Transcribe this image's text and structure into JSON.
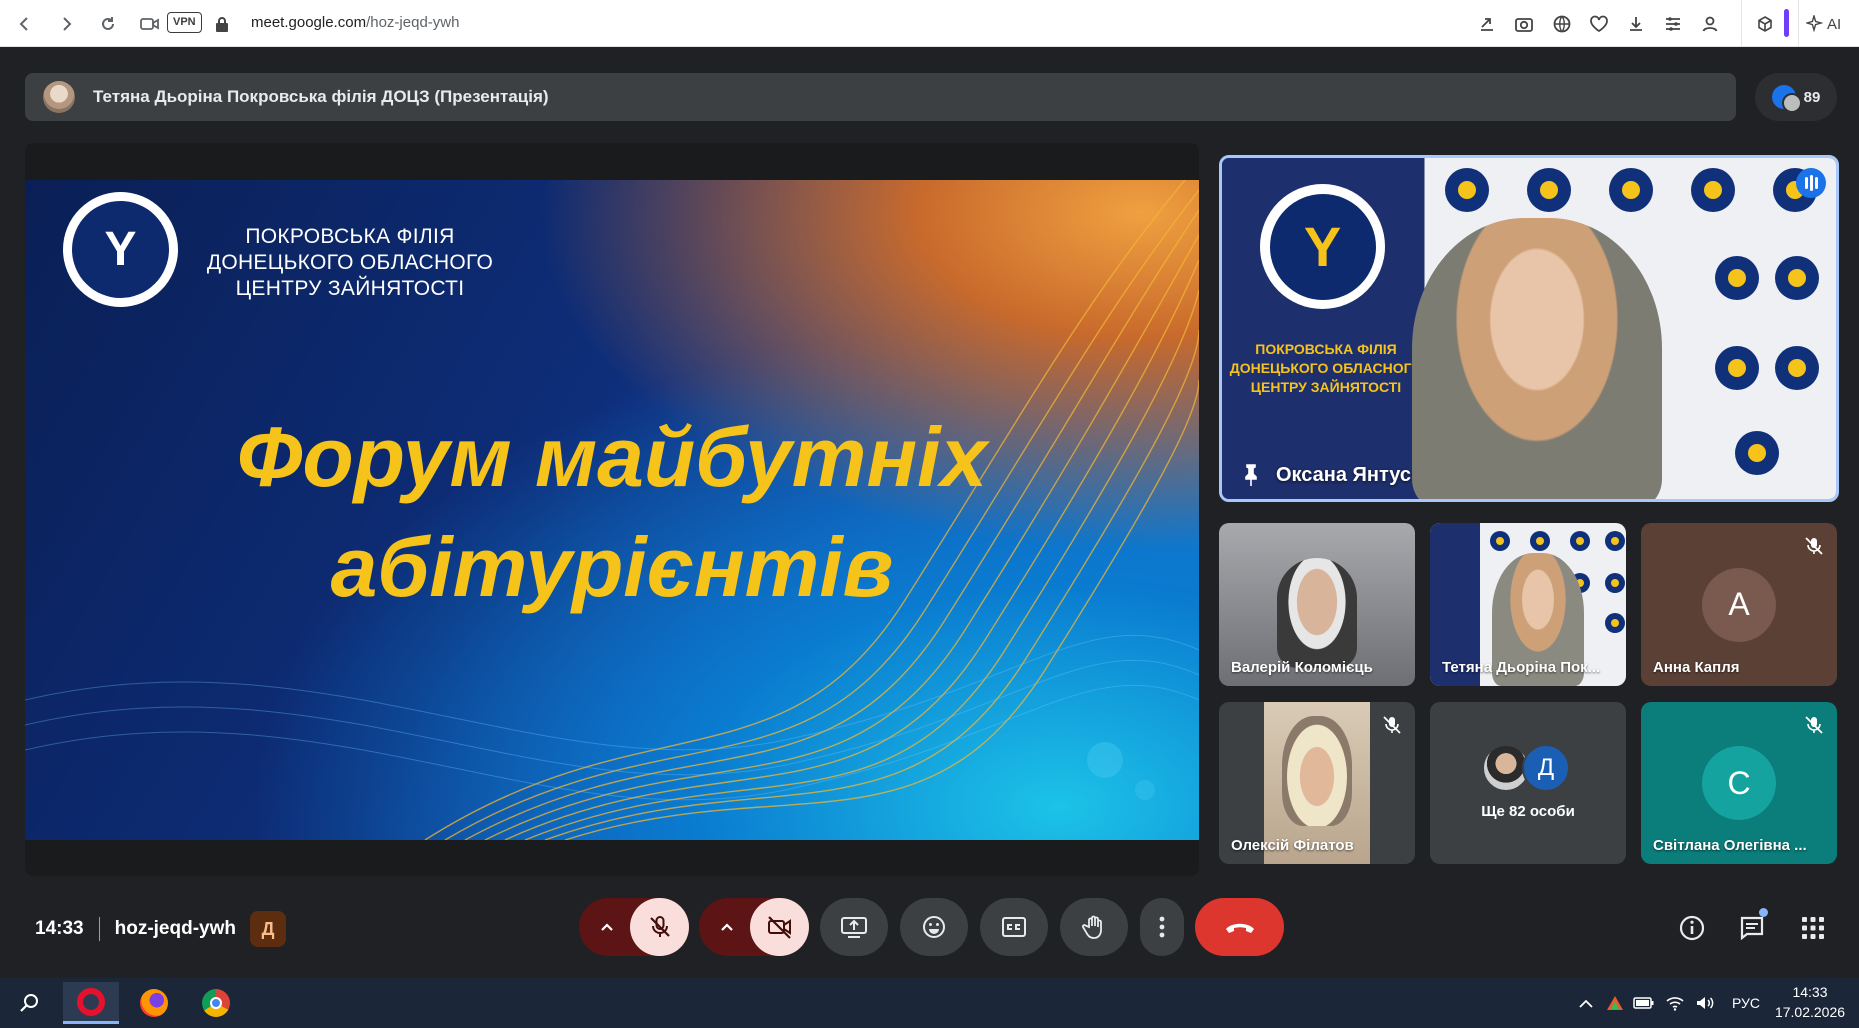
{
  "browser": {
    "vpn_label": "VPN",
    "url_domain": "meet.google.com",
    "url_path": "/hoz-jeqd-ywh",
    "ai_label": "AI"
  },
  "meeting": {
    "presentation_title": "Тетяна Дьоріна Покровська філія ДОЦЗ (Презентація)",
    "participant_count": "89",
    "time": "14:33",
    "code": "hoz-jeqd-ywh",
    "host_badge": "Д"
  },
  "slide": {
    "org_line1": "ПОКРОВСЬКА ФІЛІЯ",
    "org_line2": "ДОНЕЦЬКОГО ОБЛАСНОГО",
    "org_line3": "ЦЕНТРУ ЗАЙНЯТОСТІ",
    "headline_line1": "Форум майбутніх",
    "headline_line2": "абітурієнтів"
  },
  "pinned": {
    "name": "Оксана Янтус",
    "bg_line1": "ПОКРОВСЬКА ФІЛІЯ",
    "bg_line2": "ДОНЕЦЬКОГО ОБЛАСНОГО",
    "bg_line3": "ЦЕНТРУ ЗАЙНЯТОСТІ"
  },
  "tiles": [
    {
      "name": "Валерій Коломієць"
    },
    {
      "name": "Тетяна Дьоріна Пок..."
    },
    {
      "name": "Анна Капля",
      "letter": "А",
      "color": "#5b4035"
    },
    {
      "name": "Олексій Філатов"
    },
    {
      "name": "Ще 82 особи",
      "letter": "Д"
    },
    {
      "name": "Світлана Олегівна ...",
      "letter": "С",
      "color": "#0b7d7a"
    }
  ],
  "taskbar": {
    "language": "РУС",
    "time": "14:33",
    "date": "17.02.2026"
  }
}
